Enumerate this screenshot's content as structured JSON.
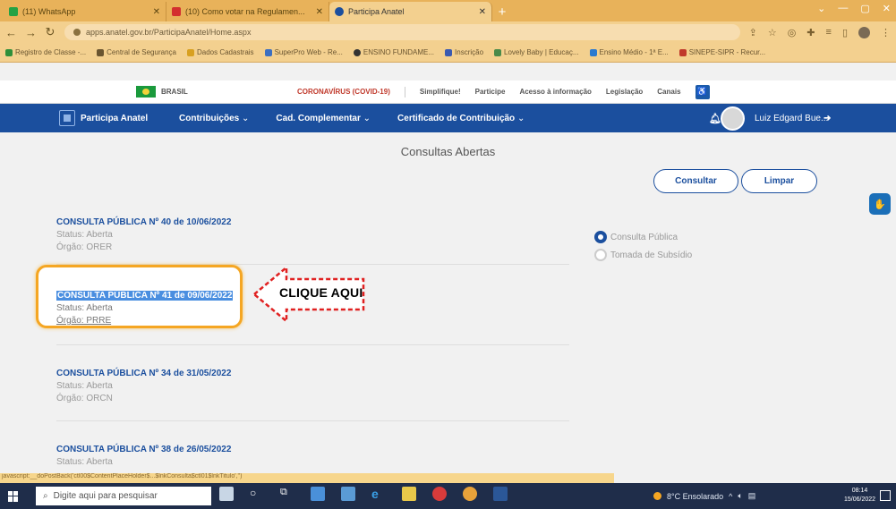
{
  "browser": {
    "tabs": [
      {
        "label": "(11) WhatsApp",
        "color": "#25a244"
      },
      {
        "label": "(10) Como votar na Regulamen...",
        "color": "#d32f2f"
      },
      {
        "label": "Participa Anatel",
        "color": "#1b4f9e"
      }
    ],
    "new_tab": "+",
    "url": "apps.anatel.gov.br/ParticipaAnatel/Home.aspx",
    "bookmarks": [
      "Registro de Classe -...",
      "Central de Segurança",
      "Dados Cadastrais",
      "SuperPro Web - Re...",
      "ENSINO FUNDAME...",
      "Inscrição",
      "Lovely Baby | Educaç...",
      "Ensino Médio - 1ª E...",
      "SINEPE-SIPR - Recur..."
    ]
  },
  "gov_bar": {
    "brasil": "BRASIL",
    "links": [
      "CORONAVÍRUS (COVID-19)",
      "Simplifique!",
      "Participe",
      "Acesso à informação",
      "Legislação",
      "Canais"
    ]
  },
  "site_nav": {
    "logo": "Participa Anatel",
    "menu": [
      "Contribuições",
      "Cad. Complementar",
      "Certificado de Contribuição"
    ],
    "user": "Luiz Edgard Bue..."
  },
  "main": {
    "title": "Consultas Abertas",
    "consultar": "Consultar",
    "limpar": "Limpar",
    "items": [
      {
        "title": "CONSULTA PÚBLICA Nº 40 de 10/06/2022",
        "status": "Status: Aberta",
        "orgao": "Órgão: ORER"
      },
      {
        "title": "CONSULTA PÚBLICA Nº 41 de 09/06/2022",
        "status": "Status: Aberta",
        "orgao": "Órgão: PRRE"
      },
      {
        "title": "CONSULTA PÚBLICA Nº 34 de 31/05/2022",
        "status": "Status: Aberta",
        "orgao": "Órgão: ORCN"
      },
      {
        "title": "CONSULTA PÚBLICA Nº 38 de 26/05/2022",
        "status": "Status: Aberta",
        "orgao": ""
      }
    ],
    "filters": [
      {
        "label": "Consulta Pública",
        "selected": true
      },
      {
        "label": "Tomada de Subsídio",
        "selected": false
      }
    ],
    "callout": "CLIQUE AQUI"
  },
  "status_url": "javascript:__doPostBack('ctl00$ContentPlaceHolder$...$lnkConsulta$ctl01$lnkTitulo','')",
  "taskbar": {
    "search_placeholder": "Digite aqui para pesquisar",
    "weather": "8°C Ensolarado",
    "time": "08:14",
    "date": "15/06/2022"
  }
}
